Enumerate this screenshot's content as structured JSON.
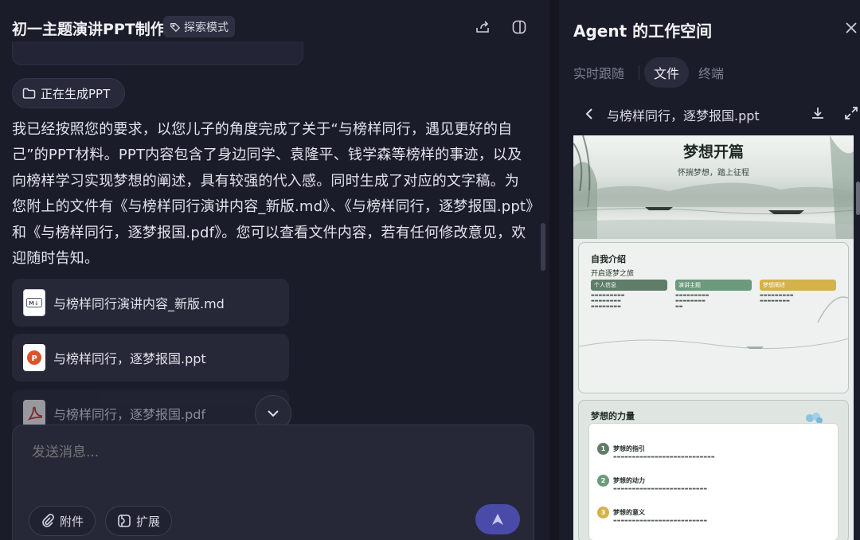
{
  "header": {
    "title": "初一主题演讲PPT制作",
    "mode_badge": "探索模式",
    "share_icon": "share-icon",
    "sidebar_icon": "sidebar-toggle-icon"
  },
  "chat": {
    "status_chip": "正在生成PPT",
    "reply": "我已经按照您的要求，以您儿子的角度完成了关于“与榜样同行，遇见更好的自己”的PPT材料。PPT内容包含了身边同学、袁隆平、钱学森等榜样的事迹，以及向榜样学习实现梦想的阐述，具有较强的代入感。同时生成了对应的文字稿。为您附上的文件有《与榜样同行演讲内容_新版.md》、《与榜样同行，逐梦报国.ppt》和《与榜样同行，逐梦报国.pdf》。您可以查看文件内容，若有任何修改意见，欢迎随时告知。",
    "files": [
      {
        "name": "与榜样同行演讲内容_新版.md",
        "icon": "markdown-file-icon"
      },
      {
        "name": "与榜样同行，逐梦报国.ppt",
        "icon": "ppt-file-icon"
      },
      {
        "name": "与榜样同行，逐梦报国.pdf",
        "icon": "pdf-file-icon"
      }
    ]
  },
  "composer": {
    "placeholder": "发送消息...",
    "attach_label": "附件",
    "expand_label": "扩展"
  },
  "workspace": {
    "title": "Agent 的工作空间",
    "tabs": [
      {
        "label": "实时跟随",
        "active": false
      },
      {
        "label": "文件",
        "active": true
      },
      {
        "label": "终端",
        "active": false
      }
    ],
    "file_name": "与榜样同行，逐梦报国.ppt"
  },
  "preview": {
    "slide1": {
      "title": "梦想开篇",
      "subtitle": "怀揣梦想，踏上征程"
    },
    "slide2": {
      "heading": "自我介绍",
      "subheading": "开启逐梦之旅",
      "columns": [
        {
          "label": "个人信息",
          "color": "#5f7d69"
        },
        {
          "label": "演讲主题",
          "color": "#6b9a7c"
        },
        {
          "label": "梦想阐述",
          "color": "#d4b24a"
        }
      ]
    },
    "slide3": {
      "heading": "梦想的力量",
      "items": [
        {
          "num": "1",
          "title": "梦想的指引",
          "color": "#5f7d69"
        },
        {
          "num": "2",
          "title": "梦想的动力",
          "color": "#6b9a7c"
        },
        {
          "num": "3",
          "title": "梦想的意义",
          "color": "#d4b24a"
        }
      ]
    }
  },
  "colors": {
    "background": "#1b1c2a",
    "card": "#262838",
    "send_button": "#4a4aa8",
    "accent_green": "#5f7d69",
    "accent_gold": "#d4b24a"
  }
}
